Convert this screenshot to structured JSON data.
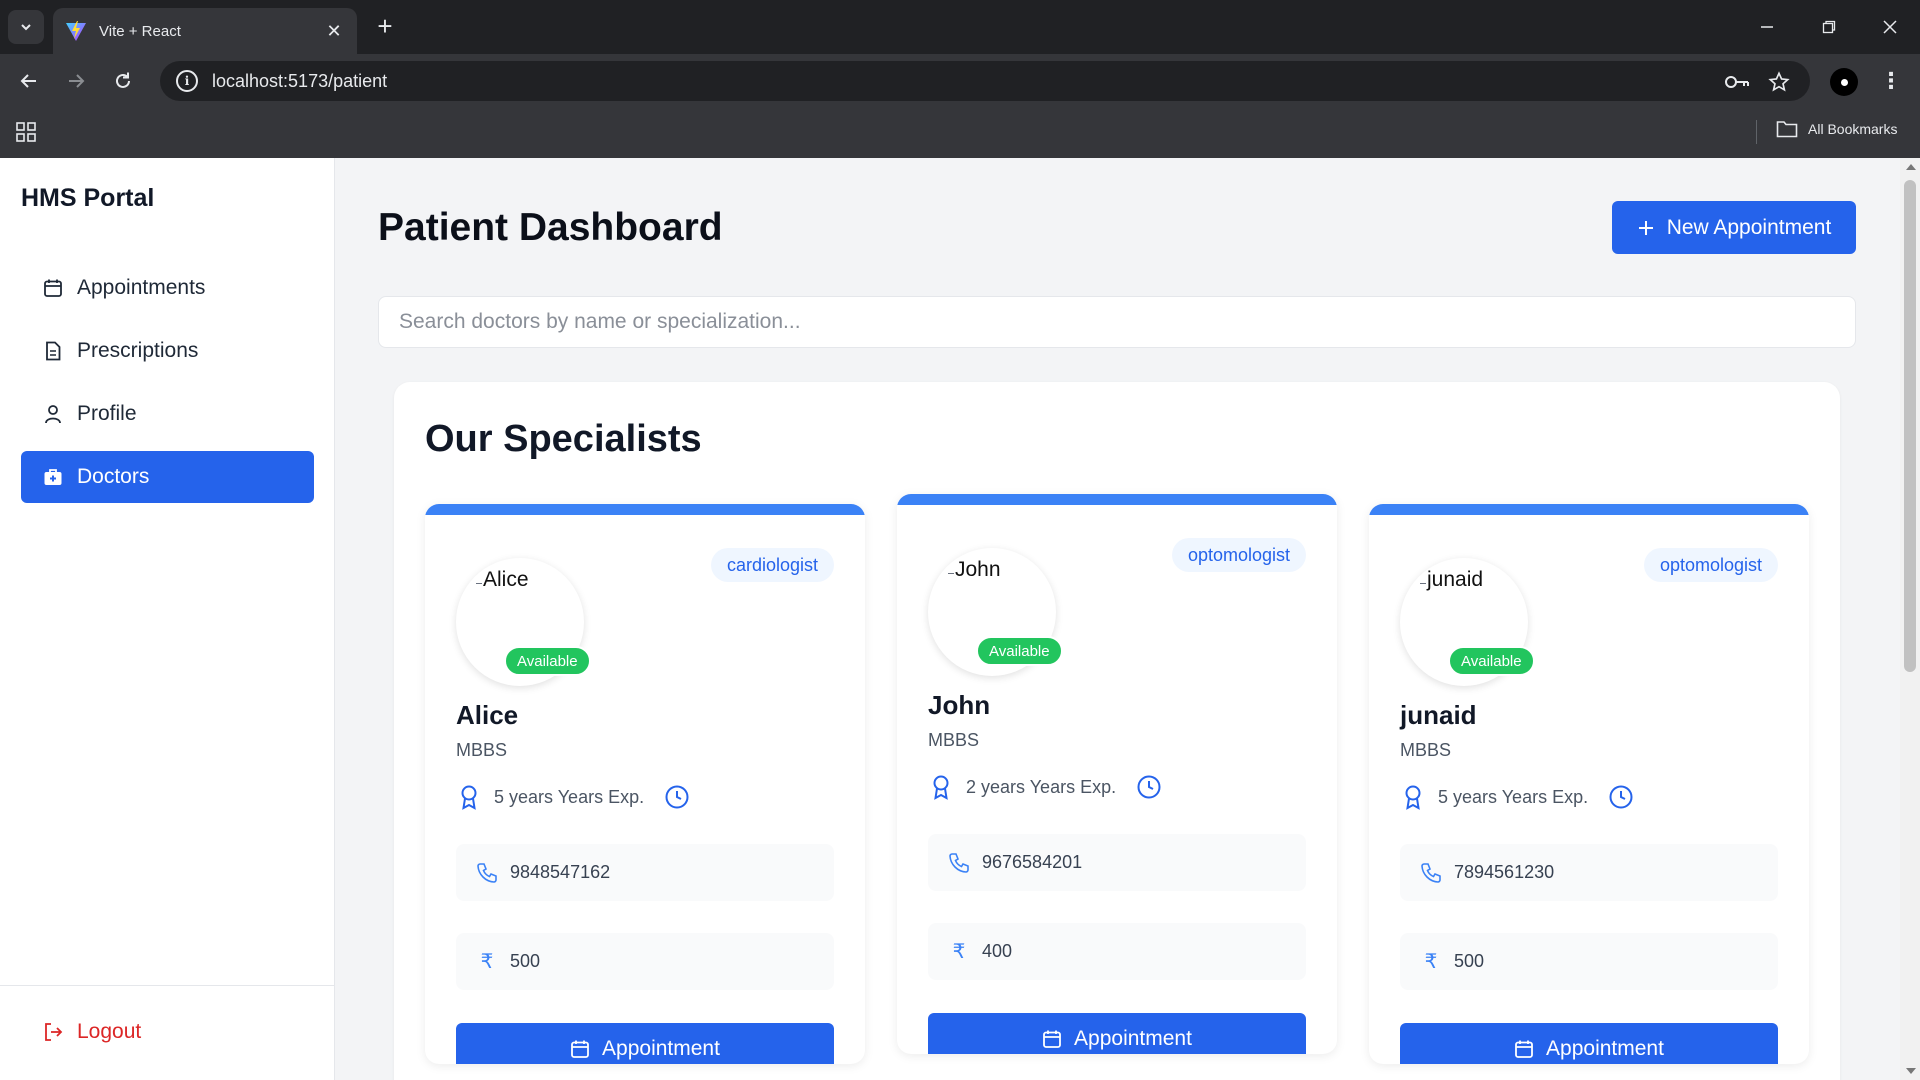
{
  "browser": {
    "tab_title": "Vite + React",
    "url": "localhost:5173/patient",
    "all_bookmarks": "All Bookmarks"
  },
  "sidebar": {
    "brand": "HMS Portal",
    "items": [
      {
        "label": "Appointments",
        "icon": "calendar-icon"
      },
      {
        "label": "Prescriptions",
        "icon": "document-icon"
      },
      {
        "label": "Profile",
        "icon": "user-icon"
      },
      {
        "label": "Doctors",
        "icon": "briefcase-medical-icon",
        "active": true
      }
    ],
    "logout": "Logout"
  },
  "header": {
    "title": "Patient Dashboard",
    "new_appointment": "New Appointment"
  },
  "search": {
    "placeholder": "Search doctors by name or specialization..."
  },
  "specialists": {
    "title": "Our Specialists",
    "doctors": [
      {
        "alt": "Alice",
        "name": "Alice",
        "degree": "MBBS",
        "specialization": "cardiologist",
        "status": "Available",
        "experience": "5 years Years Exp.",
        "phone": "9848547162",
        "fee": "500",
        "button": "Appointment"
      },
      {
        "alt": "John",
        "name": "John",
        "degree": "MBBS",
        "specialization": "optomologist",
        "status": "Available",
        "experience": "2 years Years Exp.",
        "phone": "9676584201",
        "fee": "400",
        "button": "Appointment"
      },
      {
        "alt": "junaid",
        "name": "junaid",
        "degree": "MBBS",
        "specialization": "optomologist",
        "status": "Available",
        "experience": "5 years Years Exp.",
        "phone": "7894561230",
        "fee": "500",
        "button": "Appointment"
      }
    ]
  },
  "colors": {
    "primary": "#2563eb",
    "available": "#22c55e",
    "logout": "#dc2626",
    "pill_bg": "#eff6ff"
  }
}
